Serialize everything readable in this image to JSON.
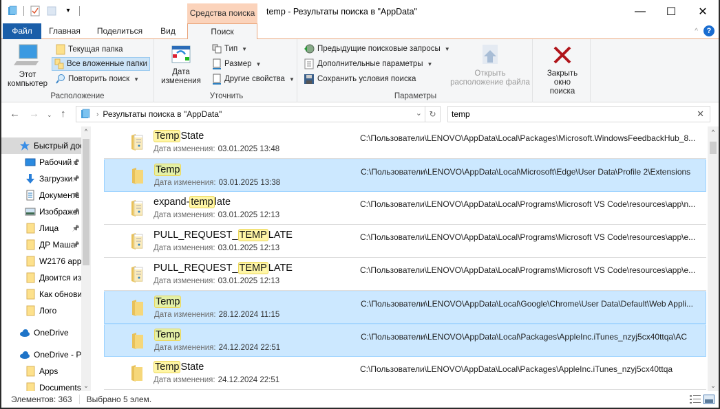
{
  "window": {
    "title": "temp - Результаты поиска в \"AppData\"",
    "context_tab_header": "Средства поиска",
    "controls": {
      "minimize": "—",
      "maximize": "☐",
      "close": "✕"
    }
  },
  "ribbon_tabs": [
    {
      "label": "Файл"
    },
    {
      "label": "Главная"
    },
    {
      "label": "Поделиться"
    },
    {
      "label": "Вид"
    },
    {
      "label": "Поиск"
    }
  ],
  "help_label": "?",
  "ribbon": {
    "location": {
      "label": "Расположение",
      "this_pc": "Этот компьютер",
      "current_folder": "Текущая папка",
      "all_subfolders": "Все вложенные папки",
      "repeat_search": "Повторить поиск"
    },
    "refine": {
      "label": "Уточнить",
      "date_modified": "Дата изменения",
      "type": "Тип",
      "size": "Размер",
      "other_properties": "Другие свойства"
    },
    "options": {
      "label": "Параметры",
      "recent_searches": "Предыдущие поисковые запросы",
      "advanced_options": "Дополнительные параметры",
      "save_search": "Сохранить условия поиска",
      "open_file_location": "Открыть расположение файла"
    },
    "close_search": "Закрыть окно поиска"
  },
  "address_bar": {
    "path": "Результаты поиска в \"AppData\"",
    "search_value": "temp"
  },
  "nav_pane": {
    "items": [
      {
        "label": "Быстрый доступ",
        "icon": "star-icon",
        "pinned": false
      },
      {
        "label": "Рабочий стол",
        "icon": "desktop-icon",
        "pinned": true
      },
      {
        "label": "Загрузки",
        "icon": "download-icon",
        "pinned": true
      },
      {
        "label": "Документы",
        "icon": "document-icon",
        "pinned": true
      },
      {
        "label": "Изображения",
        "icon": "pictures-icon",
        "pinned": true
      },
      {
        "label": "Лица",
        "icon": "folder-icon",
        "pinned": true
      },
      {
        "label": "ДР Маша",
        "icon": "folder-icon",
        "pinned": true
      },
      {
        "label": "W2176 app",
        "icon": "folder-icon",
        "pinned": false
      },
      {
        "label": "Двоится из",
        "icon": "folder-icon",
        "pinned": false
      },
      {
        "label": "Как обнови",
        "icon": "folder-icon",
        "pinned": false
      },
      {
        "label": "Лого",
        "icon": "folder-icon",
        "pinned": false
      },
      {
        "label": "OneDrive",
        "icon": "cloud-icon",
        "pinned": false
      },
      {
        "label": "OneDrive - P",
        "icon": "cloud-icon",
        "pinned": false
      },
      {
        "label": "Apps",
        "icon": "folder-icon",
        "pinned": false
      },
      {
        "label": "Documents",
        "icon": "folder-icon",
        "pinned": false
      }
    ]
  },
  "results": [
    {
      "pre": "",
      "hl": "Temp",
      "post": "State",
      "date_label": "Дата изменения:",
      "date": "03.01.2025 13:48",
      "path": "C:\\Пользователи\\LENOVO\\AppData\\Local\\Packages\\Microsoft.WindowsFeedbackHub_8...",
      "selected": false,
      "icon": "doc-folder"
    },
    {
      "pre": "",
      "hl": "Temp",
      "post": "",
      "date_label": "Дата изменения:",
      "date": "03.01.2025 13:38",
      "path": "C:\\Пользователи\\LENOVO\\AppData\\Local\\Microsoft\\Edge\\User Data\\Profile 2\\Extensions",
      "selected": true,
      "icon": "folder"
    },
    {
      "pre": "expand-",
      "hl": "temp",
      "post": "late",
      "date_label": "Дата изменения:",
      "date": "03.01.2025 12:13",
      "path": "C:\\Пользователи\\LENOVO\\AppData\\Local\\Programs\\Microsoft VS Code\\resources\\app\\n...",
      "selected": false,
      "icon": "doc-folder"
    },
    {
      "pre": "PULL_REQUEST_",
      "hl": "TEMP",
      "post": "LATE",
      "date_label": "Дата изменения:",
      "date": "03.01.2025 12:13",
      "path": "C:\\Пользователи\\LENOVO\\AppData\\Local\\Programs\\Microsoft VS Code\\resources\\app\\e...",
      "selected": false,
      "icon": "doc-folder"
    },
    {
      "pre": "PULL_REQUEST_",
      "hl": "TEMP",
      "post": "LATE",
      "date_label": "Дата изменения:",
      "date": "03.01.2025 12:13",
      "path": "C:\\Пользователи\\LENOVO\\AppData\\Local\\Programs\\Microsoft VS Code\\resources\\app\\e...",
      "selected": false,
      "icon": "doc-folder"
    },
    {
      "pre": "",
      "hl": "Temp",
      "post": "",
      "date_label": "Дата изменения:",
      "date": "28.12.2024 11:15",
      "path": "C:\\Пользователи\\LENOVO\\AppData\\Local\\Google\\Chrome\\User Data\\Default\\Web Appli...",
      "selected": true,
      "icon": "folder"
    },
    {
      "pre": "",
      "hl": "Temp",
      "post": "",
      "date_label": "Дата изменения:",
      "date": "24.12.2024 22:51",
      "path": "C:\\Пользователи\\LENOVO\\AppData\\Local\\Packages\\AppleInc.iTunes_nzyj5cx40ttqa\\AC",
      "selected": true,
      "icon": "folder"
    },
    {
      "pre": "",
      "hl": "Temp",
      "post": "State",
      "date_label": "Дата изменения:",
      "date": "24.12.2024 22:51",
      "path": "C:\\Пользователи\\LENOVO\\AppData\\Local\\Packages\\AppleInc.iTunes_nzyj5cx40ttqa",
      "selected": false,
      "icon": "folder"
    }
  ],
  "status_bar": {
    "item_count": "Элементов: 363",
    "selected_count": "Выбрано 5 элем."
  }
}
